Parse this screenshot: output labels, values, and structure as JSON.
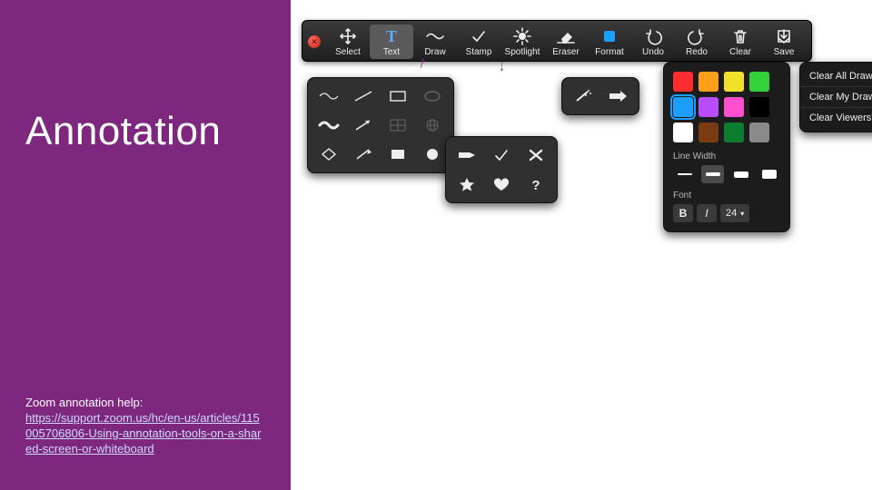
{
  "sidebar": {
    "title": "Annotation",
    "help_label": "Zoom annotation help:",
    "help_url_text": "https://support.zoom.us/hc/en-us/articles/115005706806-Using-annotation-tools-on-a-shared-screen-or-whiteboard"
  },
  "toolbar": {
    "items": [
      {
        "id": "select",
        "label": "Select",
        "icon": "move"
      },
      {
        "id": "text",
        "label": "Text",
        "icon": "text",
        "active": true
      },
      {
        "id": "draw",
        "label": "Draw",
        "icon": "wavy"
      },
      {
        "id": "stamp",
        "label": "Stamp",
        "icon": "check"
      },
      {
        "id": "spotlight",
        "label": "Spotlight",
        "icon": "spot"
      },
      {
        "id": "eraser",
        "label": "Eraser",
        "icon": "eraser"
      },
      {
        "id": "format",
        "label": "Format",
        "icon": "format"
      },
      {
        "id": "undo",
        "label": "Undo",
        "icon": "undo"
      },
      {
        "id": "redo",
        "label": "Redo",
        "icon": "redo"
      },
      {
        "id": "clear",
        "label": "Clear",
        "icon": "trash"
      },
      {
        "id": "save",
        "label": "Save",
        "icon": "save"
      }
    ]
  },
  "draw_panel": {
    "rows": [
      [
        "wavy-thin",
        "line-thin",
        "rect-outline",
        "ellipse-outline-dim"
      ],
      [
        "wavy-thick",
        "arrow-diag",
        "grid-dim",
        "globe-dim"
      ],
      [
        "diamond-outline",
        "arrow-ne",
        "rect-fill",
        "circle-fill"
      ]
    ]
  },
  "stamp_panel": {
    "rows": [
      [
        "arrow-tag",
        "check",
        "x"
      ],
      [
        "star",
        "heart",
        "question"
      ]
    ]
  },
  "spotlight_panel": {
    "items": [
      "wand",
      "arrow-right"
    ]
  },
  "format_panel": {
    "colors": [
      {
        "hex": "#ff2d2d"
      },
      {
        "hex": "#ff9f1a"
      },
      {
        "hex": "#f0e02a"
      },
      {
        "hex": "#33d13a"
      },
      {
        "hex": "#1a9fff",
        "selected": true
      },
      {
        "hex": "#b94cff"
      },
      {
        "hex": "#ff4fd0"
      },
      {
        "hex": "#000000"
      },
      {
        "hex": "#ffffff"
      },
      {
        "hex": "#7a3b12"
      },
      {
        "hex": "#0a7d2e"
      },
      {
        "hex": "#8a8a8a"
      }
    ],
    "line_width_label": "Line Width",
    "line_widths": [
      2,
      4,
      7,
      10
    ],
    "line_width_selected_index": 1,
    "font_label": "Font",
    "bold_label": "B",
    "italic_label": "I",
    "font_size": "24"
  },
  "clear_menu": {
    "items": [
      "Clear All Drawings",
      "Clear My Drawings",
      "Clear Viewers' Drawings"
    ]
  }
}
